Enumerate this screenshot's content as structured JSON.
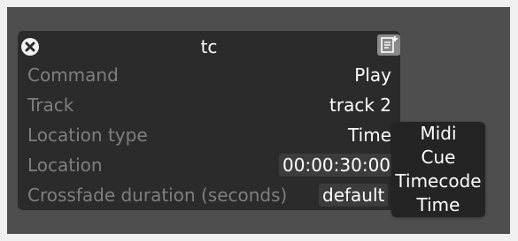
{
  "panel": {
    "title": "tc",
    "rows": [
      {
        "label": "Command",
        "value": "Play"
      },
      {
        "label": "Track",
        "value": "track 2"
      },
      {
        "label": "Location type",
        "value": "Time"
      },
      {
        "label": "Location",
        "value": "00:00:30:00"
      },
      {
        "label": "Crossfade duration (seconds)",
        "value": "default"
      }
    ]
  },
  "dropdown": {
    "options": [
      "Midi",
      "Cue",
      "Timecode",
      "Time"
    ]
  },
  "icons": {
    "close": "close-circle-icon",
    "note": "add-note-icon"
  },
  "colors": {
    "canvas": "#4e4e4e",
    "panel": "#2b2b2b",
    "label": "#7f7f7f",
    "value": "#ffffff",
    "field": "#3c3c3c",
    "dropdown": "#242424"
  }
}
